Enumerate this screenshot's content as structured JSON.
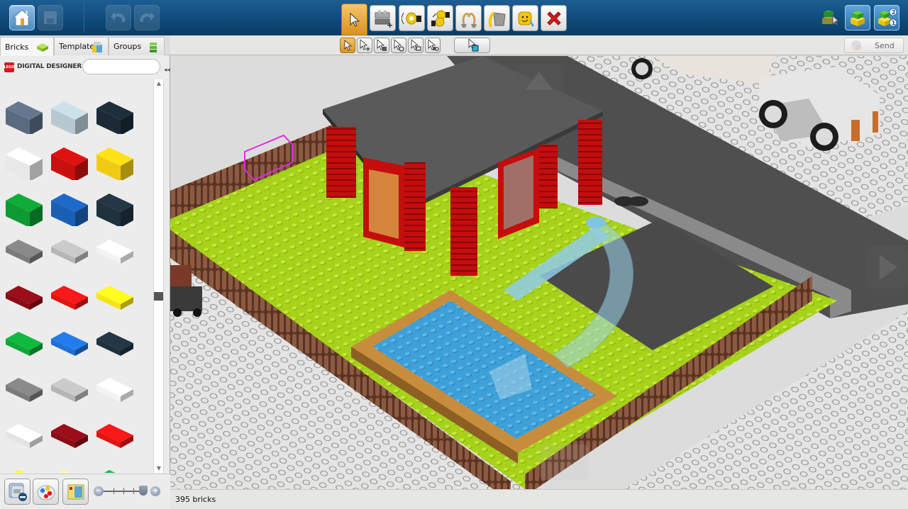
{
  "app": {
    "brand": "DIGITAL DESIGNER",
    "logo_text": "LEGO"
  },
  "topbar": {
    "left_buttons": [
      {
        "name": "home",
        "icon": "home-icon",
        "state": "active"
      },
      {
        "name": "save",
        "icon": "save-icon",
        "state": "disabled"
      },
      {
        "name": "undo",
        "icon": "undo-icon",
        "state": "disabled"
      },
      {
        "name": "redo",
        "icon": "redo-icon",
        "state": "disabled"
      }
    ],
    "tools": [
      {
        "name": "select",
        "icon": "cursor-icon",
        "active": true
      },
      {
        "name": "clone",
        "icon": "brick-add-icon",
        "active": false
      },
      {
        "name": "hinge",
        "icon": "hinge-icon",
        "active": false
      },
      {
        "name": "hinge-align",
        "icon": "hinge-align-icon",
        "active": false
      },
      {
        "name": "flex",
        "icon": "flex-rope-icon",
        "active": false
      },
      {
        "name": "paint",
        "icon": "paint-bucket-icon",
        "active": false
      },
      {
        "name": "decorate",
        "icon": "minifig-head-icon",
        "active": false
      },
      {
        "name": "delete",
        "icon": "delete-x-icon",
        "active": false
      }
    ],
    "right_buttons": [
      {
        "name": "build-mode",
        "icon": "build-mode-icon"
      },
      {
        "name": "view-mode",
        "icon": "view-mode-icon"
      },
      {
        "name": "building-guide-mode",
        "icon": "building-guide-icon",
        "badges": [
          "2",
          "1"
        ]
      }
    ]
  },
  "subbar": {
    "select_modes": [
      {
        "name": "single-select",
        "icon": "cursor-icon",
        "active": true
      },
      {
        "name": "add-select",
        "icon": "cursor-plus-icon",
        "active": false
      },
      {
        "name": "connected-select",
        "icon": "cursor-connected-icon",
        "active": false
      },
      {
        "name": "invert-select",
        "icon": "cursor-invert-icon",
        "active": false
      },
      {
        "name": "same-shape-select",
        "icon": "cursor-shape-icon",
        "active": false
      },
      {
        "name": "same-color-select",
        "icon": "cursor-color-icon",
        "active": false
      }
    ],
    "group_select": {
      "icon": "cursor-group-icon"
    },
    "send_label": "Send"
  },
  "left_panel": {
    "tabs": [
      {
        "label": "Bricks",
        "icon": "brick-icon",
        "active": true
      },
      {
        "label": "Templates",
        "icon": "templates-icon",
        "active": false
      },
      {
        "label": "Groups",
        "icon": "groups-icon",
        "active": false
      }
    ],
    "search": {
      "value": "",
      "placeholder": ""
    },
    "palette_rows": [
      [
        "#c9a316",
        "#1e7a30",
        "#1d3f7a"
      ],
      [
        "#5a6b80",
        "#b7c9d0",
        "#1b2a35"
      ],
      [
        "#e8e8e8",
        "#c8100f",
        "#f0cb14"
      ],
      [
        "#0d9a32",
        "#1a5fb4",
        "#1f313d"
      ],
      [
        "#7b7b7b",
        "#b5b5b5",
        "#f3f3f3"
      ],
      [
        "#8a0c15",
        "#e01515",
        "#f5e31a"
      ],
      [
        "#0ea63a",
        "#1f6fd4",
        "#1f313d"
      ],
      [
        "#7b7b7b",
        "#b5b5b5",
        "#f3f3f3"
      ],
      [
        "#e3e3e3",
        "#8a0c15",
        "#e01515"
      ],
      [
        "#f2e21a",
        "#efe47a",
        "#0ea63a"
      ]
    ],
    "zoom_slider": {
      "value": 1.0
    },
    "bottom_buttons": [
      {
        "name": "hide-bricks",
        "icon": "hide-brick-icon"
      },
      {
        "name": "color-palette",
        "icon": "color-palette-icon"
      },
      {
        "name": "sort-bricks",
        "icon": "sort-bricks-icon"
      }
    ]
  },
  "status": {
    "brick_count": "395 bricks"
  },
  "colors": {
    "accent_orange": "#e3a334",
    "header_blue": "#0f4a7a",
    "baseplate_lime": "#a6d21a",
    "pool_blue": "#3ea0d9",
    "fence_brown": "#7a4a34",
    "roof_gray": "#5a5a5a",
    "red_brick": "#c40d0d"
  }
}
